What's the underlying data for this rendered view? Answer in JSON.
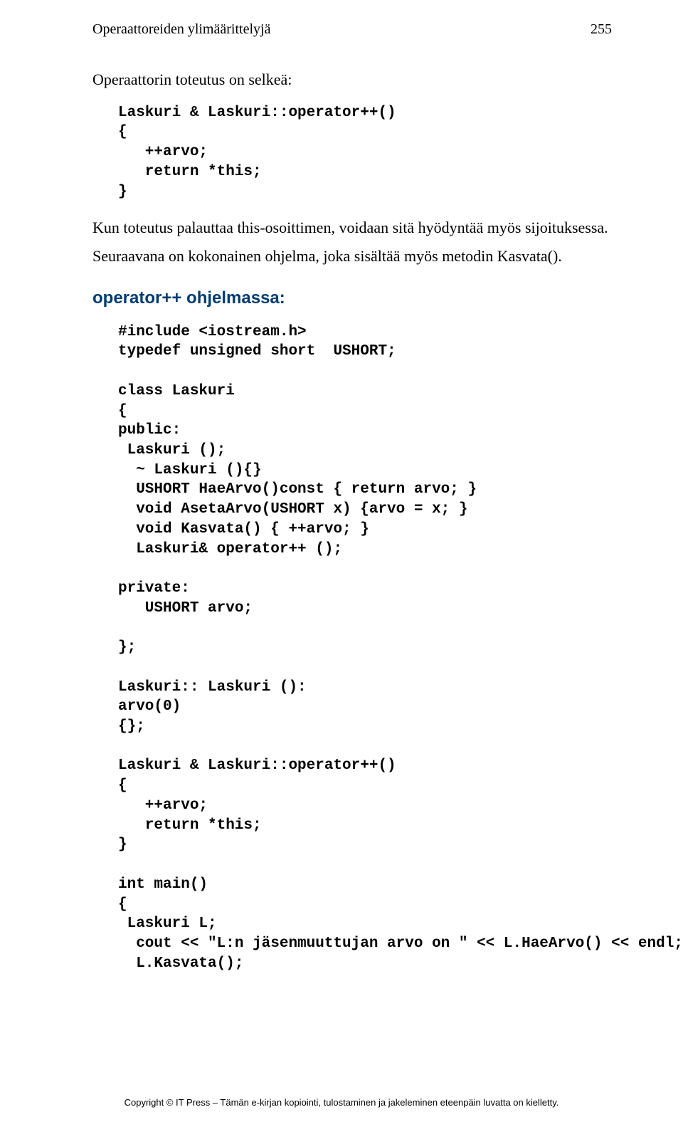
{
  "header": {
    "title": "Operaattoreiden ylimäärittelyjä",
    "page_number": "255"
  },
  "para1": "Operaattorin toteutus on selkeä:",
  "code1": "Laskuri & Laskuri::operator++()\n{\n   ++arvo;\n   return *this;\n}",
  "para2": "Kun toteutus palauttaa this-osoittimen, voidaan sitä hyödyntää myös sijoituksessa.",
  "para3": "Seuraavana on kokonainen ohjelma, joka sisältää myös metodin Kasvata().",
  "section_title": "operator++ ohjelmassa:",
  "code2": "#include <iostream.h>\ntypedef unsigned short  USHORT;\n\nclass Laskuri\n{\npublic:\n Laskuri ();\n  ~ Laskuri (){}\n  USHORT HaeArvo()const { return arvo; }\n  void AsetaArvo(USHORT x) {arvo = x; }\n  void Kasvata() { ++arvo; }\n  Laskuri& operator++ ();\n\nprivate:\n   USHORT arvo;\n\n};\n\nLaskuri:: Laskuri ():\narvo(0)\n{};\n\nLaskuri & Laskuri::operator++()\n{\n   ++arvo;\n   return *this;\n}\n\nint main()\n{\n Laskuri L;\n  cout << \"L:n jäsenmuuttujan arvo on \" << L.HaeArvo() << endl;\n  L.Kasvata();",
  "footer": "Copyright © IT Press – Tämän e-kirjan kopiointi, tulostaminen ja jakeleminen eteenpäin luvatta on kielletty."
}
